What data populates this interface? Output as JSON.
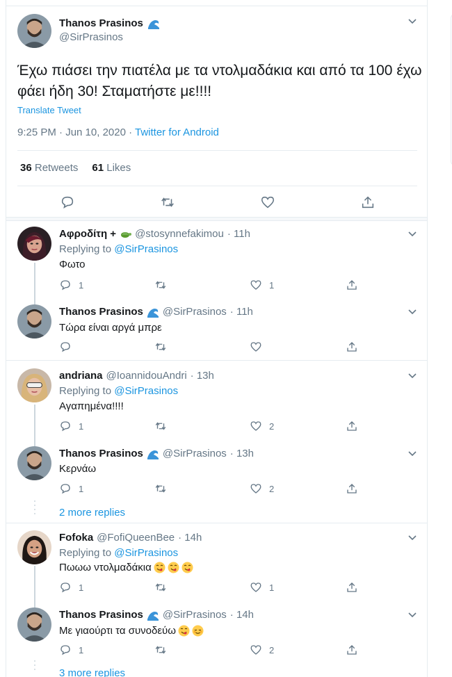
{
  "main_tweet": {
    "name": "Thanos Prasinos",
    "handle": "@SirPrasinos",
    "text": "Έχω πιάσει την πιατέλα με τα ντολμαδάκια και από τα 100 έχω φάει ήδη 30! Σταματήστε με!!!!",
    "translate": "Translate Tweet",
    "time": "9:25 PM · Jun 10, 2020 · ",
    "source": "Twitter for Android",
    "retweets_count": "36",
    "retweets_label": "Retweets",
    "likes_count": "61",
    "likes_label": "Likes"
  },
  "replies": [
    {
      "name": "Αφροδίτη +",
      "handle": "@stosynnefakimou",
      "time": "· 11h",
      "replying_label": "Replying to",
      "replying_to": "@SirPrasinos",
      "text": "Φωτο",
      "reply_count": "1",
      "retweet_count": "",
      "like_count": "1",
      "avatar": "woman-dark-hair"
    },
    {
      "name": "Thanos Prasinos",
      "handle": "@SirPrasinos",
      "time": "· 11h",
      "text": "Τώρα είναι αργά μπρε",
      "reply_count": "",
      "retweet_count": "",
      "like_count": "",
      "avatar": "man-beard"
    },
    {
      "name": "andriana",
      "handle": "@IoannidouAndri",
      "time": "· 13h",
      "replying_label": "Replying to",
      "replying_to": "@SirPrasinos",
      "text": "Αγαπημένα!!!!",
      "reply_count": "1",
      "retweet_count": "",
      "like_count": "2",
      "avatar": "woman-blonde-glasses"
    },
    {
      "name": "Thanos Prasinos",
      "handle": "@SirPrasinos",
      "time": "· 13h",
      "text": "Κερνάω",
      "reply_count": "1",
      "retweet_count": "",
      "like_count": "2",
      "avatar": "man-beard"
    },
    {
      "name": "Fofoka",
      "handle": "@FofiQueenBee",
      "time": "· 14h",
      "replying_label": "Replying to",
      "replying_to": "@SirPrasinos",
      "text": "Πωωω ντολμαδάκια",
      "reply_count": "1",
      "retweet_count": "",
      "like_count": "1",
      "avatar": "woman-smiling"
    },
    {
      "name": "Thanos Prasinos",
      "handle": "@SirPrasinos",
      "time": "· 14h",
      "text": "Με γιαούρτι τα συνοδεύω",
      "reply_count": "1",
      "retweet_count": "",
      "like_count": "2",
      "avatar": "man-beard"
    }
  ],
  "more_replies_1": "2 more replies",
  "more_replies_2": "3 more replies",
  "colors": {
    "link": "#1b95e0",
    "muted": "#657786",
    "border": "#e6ecf0",
    "text": "#14171a"
  }
}
